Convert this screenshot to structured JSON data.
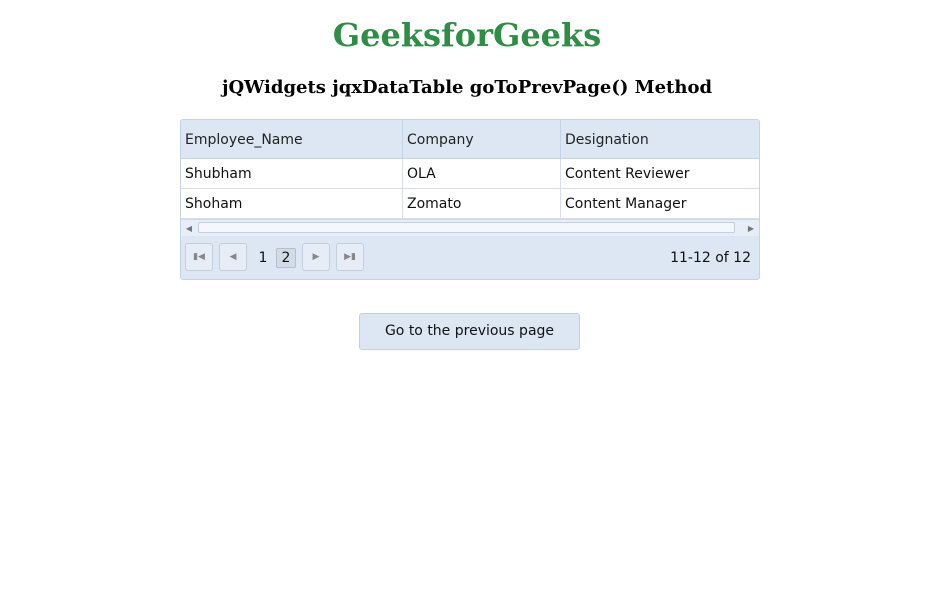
{
  "page": {
    "title": "GeeksforGeeks",
    "subtitle": "jQWidgets jqxDataTable goToPrevPage() Method"
  },
  "table": {
    "columns": [
      "Employee_Name",
      "Company",
      "Designation"
    ],
    "rows": [
      [
        "Shubham",
        "OLA",
        "Content Reviewer"
      ],
      [
        "Shoham",
        "Zomato",
        "Content Manager"
      ]
    ]
  },
  "pager": {
    "first_icon": "first-page-icon",
    "prev_icon": "prev-page-icon",
    "next_icon": "next-page-icon",
    "last_icon": "last-page-icon",
    "pages": [
      "1",
      "2"
    ],
    "current_page": "2",
    "info": "11-12 of 12"
  },
  "button": {
    "label": "Go to the previous page"
  },
  "colors": {
    "title": "#2f8d46",
    "header_bg": "#dde7f3",
    "border": "#c5d3e6"
  }
}
